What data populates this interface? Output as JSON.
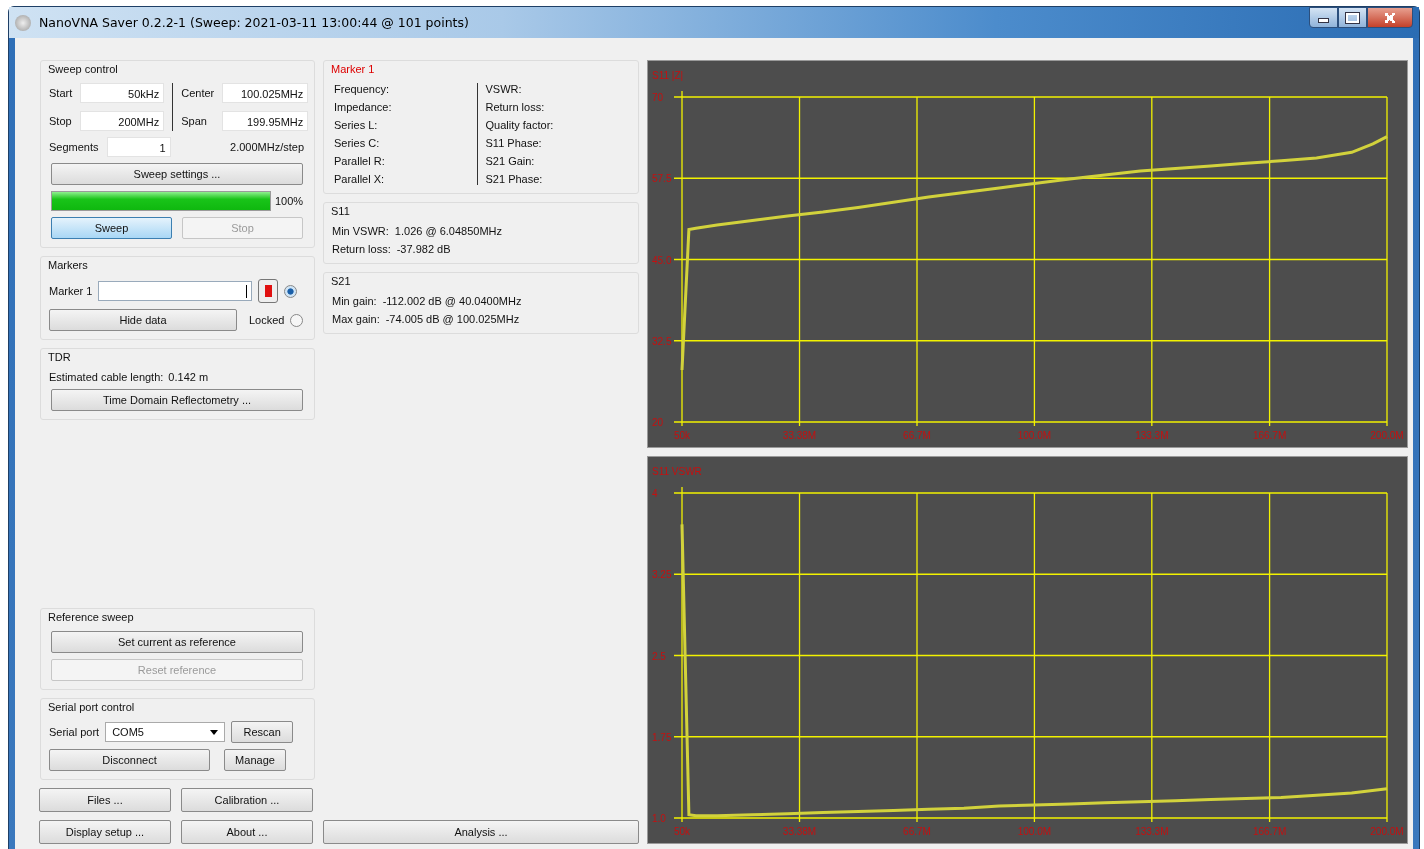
{
  "window": {
    "title": "NanoVNA Saver 0.2.2-1 (Sweep: 2021-03-11 13:00:44 @ 101 points)"
  },
  "sweep_control": {
    "title": "Sweep control",
    "start": {
      "label": "Start",
      "value": "50kHz"
    },
    "stop": {
      "label": "Stop",
      "value": "200MHz"
    },
    "center": {
      "label": "Center",
      "value": "100.025MHz"
    },
    "span": {
      "label": "Span",
      "value": "199.95MHz"
    },
    "segments": {
      "label": "Segments",
      "value": "1"
    },
    "step": "2.000MHz/step",
    "settings_button": "Sweep settings ...",
    "progress": {
      "level": 1,
      "reading": "100%"
    },
    "buttons": [
      {
        "label": "Sweep",
        "focused": true,
        "disabled": false
      },
      {
        "label": "Stop",
        "focused": false,
        "disabled": true
      }
    ]
  },
  "markers": {
    "title": "Markers",
    "rows": [
      {
        "label": "Marker 1",
        "color": "#e01010",
        "selected": true
      }
    ],
    "hide_data_button": "Hide data",
    "locked": {
      "label": "Locked",
      "checked": false
    }
  },
  "tdr": {
    "title": "TDR",
    "cable_length": {
      "label": "Estimated cable length:",
      "value": "0.142 m"
    },
    "button": "Time Domain Reflectometry ..."
  },
  "reference_sweep": {
    "title": "Reference sweep",
    "buttons": [
      {
        "label": "Set current as reference",
        "disabled": false
      },
      {
        "label": "Reset reference",
        "disabled": true
      }
    ]
  },
  "serial_port": {
    "title": "Serial port control",
    "label": "Serial port",
    "port": "COM5",
    "rescan_button": "Rescan",
    "disconnect_button": "Disconnect",
    "manage_button": "Manage"
  },
  "bottom_buttons": [
    [
      "Files ...",
      "Calibration ..."
    ],
    [
      "Display setup ...",
      "About ..."
    ]
  ],
  "marker_panel": {
    "title": "Marker 1",
    "left_fields": [
      "Frequency:",
      "Impedance:",
      "Series L:",
      "Series C:",
      "Parallel R:",
      "Parallel X:"
    ],
    "right_fields": [
      "VSWR:",
      "Return loss:",
      "Quality factor:",
      "S11 Phase:",
      "S21 Gain:",
      "S21 Phase:"
    ]
  },
  "s11_panel": {
    "title": "S11",
    "rows": [
      {
        "label": "Min VSWR:",
        "value": "1.026 @ 6.04850MHz"
      },
      {
        "label": "Return loss:",
        "value": "-37.982 dB"
      }
    ]
  },
  "s21_panel": {
    "title": "S21",
    "rows": [
      {
        "label": "Min gain:",
        "value": "-112.002 dB @ 40.0400MHz"
      },
      {
        "label": "Max gain:",
        "value": "-74.005 dB @ 100.025MHz"
      }
    ]
  },
  "analysis_button": "Analysis ...",
  "charts": [
    {
      "chart_data": {
        "type": "line",
        "title": "S11 |Z|",
        "x": [
          50000,
          2000000,
          4000000,
          10000000,
          20000000,
          30000000,
          40000000,
          50000000,
          60000000,
          70000000,
          80000000,
          90000000,
          100000000,
          110000000,
          120000000,
          130000000,
          140000000,
          150000000,
          160000000,
          170000000,
          180000000,
          190000000,
          196000000,
          200000000
        ],
        "grid": true,
        "series": [
          {
            "color": "#d2d23c",
            "values": [
              28,
              49.6,
              49.8,
              50.3,
              51,
              51.7,
              52.3,
              53,
              53.8,
              54.6,
              55.3,
              56,
              56.7,
              57.4,
              58,
              58.6,
              59,
              59.4,
              59.8,
              60.2,
              60.6,
              61.5,
              62.8,
              63.9
            ]
          }
        ],
        "xlim": [
          50000,
          200000000
        ],
        "ylim": [
          20,
          70
        ],
        "xticks": [
          {
            "value": 50000,
            "label": "50k"
          },
          {
            "value": 33380000,
            "label": "33.38M"
          },
          {
            "value": 66700000,
            "label": "66.7M"
          },
          {
            "value": 100000000,
            "label": "100.0M"
          },
          {
            "value": 133300000,
            "label": "133.3M"
          },
          {
            "value": 166700000,
            "label": "166.7M"
          },
          {
            "value": 200000000,
            "label": "200.0M"
          }
        ],
        "yticks": [
          20,
          32.5,
          {
            "value": 45,
            "label": "45.0"
          },
          57.5,
          70
        ]
      }
    },
    {
      "chart_data": {
        "type": "line",
        "title": "S11 VSWR",
        "x": [
          50000,
          2000000,
          4000000,
          10000000,
          20000000,
          30000000,
          40000000,
          50000000,
          60000000,
          70000000,
          80000000,
          90000000,
          100000000,
          110000000,
          120000000,
          130000000,
          140000000,
          150000000,
          160000000,
          170000000,
          180000000,
          190000000,
          200000000
        ],
        "grid": true,
        "series": [
          {
            "color": "#d2d23c",
            "values": [
              3.71,
              1.03,
              1.02,
              1.02,
              1.03,
              1.04,
              1.05,
              1.06,
              1.07,
              1.08,
              1.09,
              1.11,
              1.12,
              1.13,
              1.14,
              1.15,
              1.16,
              1.17,
              1.18,
              1.19,
              1.21,
              1.23,
              1.27
            ]
          }
        ],
        "xlim": [
          50000,
          200000000
        ],
        "ylim": [
          1,
          4
        ],
        "xticks": [
          {
            "value": 50000,
            "label": "50k"
          },
          {
            "value": 33380000,
            "label": "33.38M"
          },
          {
            "value": 66700000,
            "label": "66.7M"
          },
          {
            "value": 100000000,
            "label": "100.0M"
          },
          {
            "value": 133300000,
            "label": "133.3M"
          },
          {
            "value": 166700000,
            "label": "166.7M"
          },
          {
            "value": 200000000,
            "label": "200.0M"
          }
        ],
        "yticks": [
          {
            "value": 1,
            "label": "1.0"
          },
          1.75,
          2.5,
          3.25,
          4
        ]
      }
    }
  ]
}
